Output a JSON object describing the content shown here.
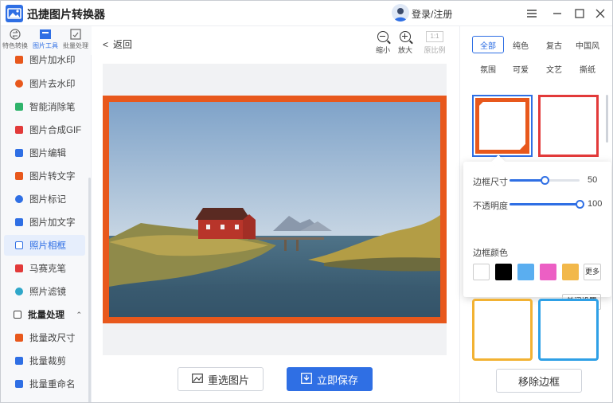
{
  "app": {
    "title": "迅捷图片转换器",
    "login": "登录/注册"
  },
  "window_controls": {
    "menu_icon": "menu-icon",
    "minimize": "minimize-icon",
    "maximize": "maximize-icon",
    "close": "close-icon"
  },
  "sidebar": {
    "top_tabs": [
      {
        "label": "特色转换",
        "icon": "convert-icon"
      },
      {
        "label": "图片工具",
        "icon": "tools-icon"
      },
      {
        "label": "批量处理",
        "icon": "batch-icon"
      }
    ],
    "items": [
      {
        "label": "图片加水印",
        "icon_color": "#e8581c"
      },
      {
        "label": "图片去水印",
        "icon_color": "#e8581c"
      },
      {
        "label": "智能消除笔",
        "icon_color": "#2fb36b"
      },
      {
        "label": "图片合成GIF",
        "icon_color": "#e23a3a"
      },
      {
        "label": "图片编辑",
        "icon_color": "#2f6fe4"
      },
      {
        "label": "图片转文字",
        "icon_color": "#e8581c"
      },
      {
        "label": "图片标记",
        "icon_color": "#2f6fe4"
      },
      {
        "label": "图片加文字",
        "icon_color": "#2f6fe4"
      },
      {
        "label": "照片相框",
        "icon_color": "#2f6fe4"
      },
      {
        "label": "马赛克笔",
        "icon_color": "#e23a3a"
      },
      {
        "label": "照片滤镜",
        "icon_color": "#2fa7c9"
      }
    ],
    "section": {
      "label": "批量处理"
    },
    "batch_items": [
      {
        "label": "批量改尺寸",
        "icon_color": "#e8581c"
      },
      {
        "label": "批量裁剪",
        "icon_color": "#2f6fe4"
      },
      {
        "label": "批量重命名",
        "icon_color": "#2f6fe4"
      }
    ]
  },
  "main": {
    "back": "返回",
    "tools": {
      "zoom_out": "缩小",
      "zoom_in": "放大",
      "ratio_badge": "1:1",
      "original": "原比例"
    },
    "buttons": {
      "reselect": "重选图片",
      "save": "立即保存"
    }
  },
  "right": {
    "filters": [
      "全部",
      "纯色",
      "复古",
      "中国风",
      "氛围",
      "可爱",
      "文艺",
      "撕纸"
    ],
    "settings": {
      "border_size_label": "边框尺寸",
      "border_size_value": "50",
      "opacity_label": "不透明度",
      "opacity_value": "100",
      "color_label": "边框颜色",
      "more": "更多",
      "close": "关闭设置"
    },
    "swatches": [
      "#ffffff",
      "#000000",
      "#5aaef0",
      "#ec5fc4",
      "#f2b84a"
    ],
    "remove_button": "移除边框"
  },
  "colors": {
    "accent": "#2f6fe4",
    "frame": "#e8581c"
  },
  "levels": {
    "border_size": 50,
    "opacity": 100
  }
}
